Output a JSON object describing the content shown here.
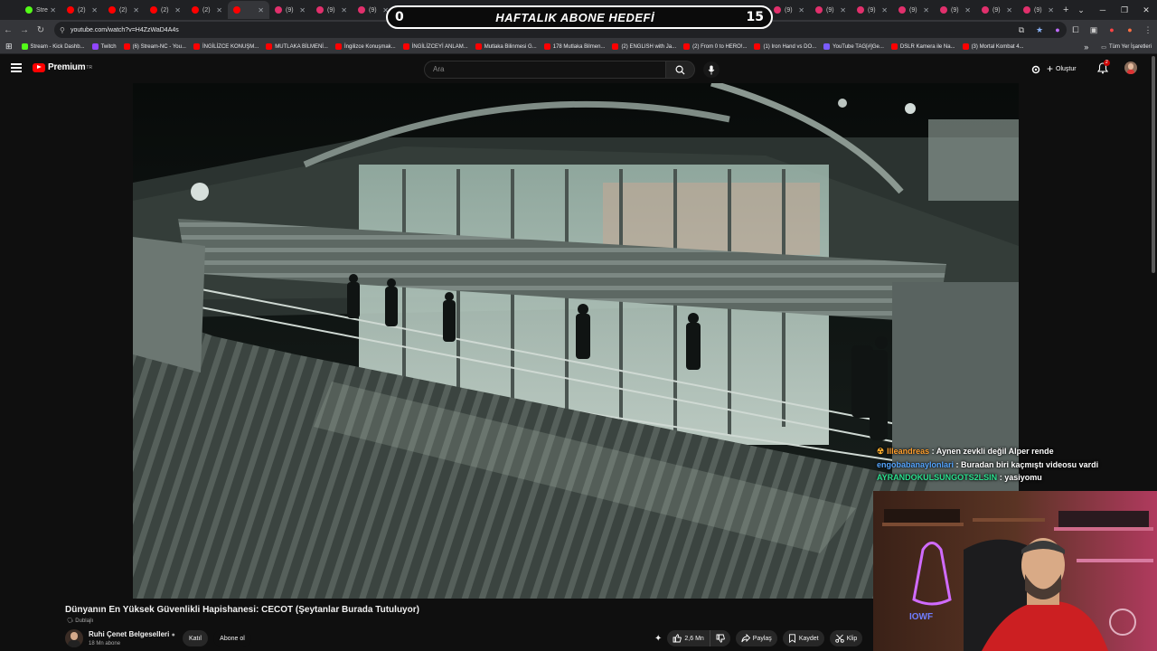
{
  "browser": {
    "tabs": [
      {
        "label": "Stre",
        "color": "#53fc18",
        "icon": "kick-icon"
      },
      {
        "label": "(2)",
        "color": "#ff0000",
        "icon": "youtube-icon"
      },
      {
        "label": "(2)",
        "color": "#ff0000",
        "icon": "youtube-icon"
      },
      {
        "label": "(2)",
        "color": "#ff0000",
        "icon": "youtube-icon"
      },
      {
        "label": "(2)",
        "color": "#ff0000",
        "icon": "youtube-icon"
      },
      {
        "label": "",
        "color": "#ff0000",
        "icon": "youtube-icon",
        "active": true
      },
      {
        "label": "(9)",
        "color": "#e1306c",
        "icon": "instagram-icon"
      },
      {
        "label": "(9)",
        "color": "#e1306c",
        "icon": "instagram-icon"
      },
      {
        "label": "(9)",
        "color": "#e1306c",
        "icon": "instagram-icon"
      },
      {
        "label": "(9)",
        "color": "#e1306c",
        "icon": "instagram-icon"
      },
      {
        "label": "(9)",
        "color": "#e1306c",
        "icon": "instagram-icon"
      },
      {
        "label": "(9)",
        "color": "#e1306c",
        "icon": "instagram-icon"
      },
      {
        "label": "(9)",
        "color": "#e1306c",
        "icon": "instagram-icon"
      },
      {
        "label": "(9)",
        "color": "#e1306c",
        "icon": "instagram-icon"
      },
      {
        "label": "(9)",
        "color": "#e1306c",
        "icon": "instagram-icon"
      },
      {
        "label": "(9)",
        "color": "#e1306c",
        "icon": "instagram-icon"
      },
      {
        "label": "(9)",
        "color": "#e1306c",
        "icon": "instagram-icon"
      },
      {
        "label": "(9)",
        "color": "#e1306c",
        "icon": "instagram-icon"
      },
      {
        "label": "(9)",
        "color": "#e1306c",
        "icon": "instagram-icon"
      },
      {
        "label": "(9)",
        "color": "#e1306c",
        "icon": "instagram-icon"
      },
      {
        "label": "(9)",
        "color": "#e1306c",
        "icon": "instagram-icon"
      },
      {
        "label": "(9)",
        "color": "#e1306c",
        "icon": "instagram-icon"
      },
      {
        "label": "(9)",
        "color": "#e1306c",
        "icon": "instagram-icon"
      },
      {
        "label": "(9)",
        "color": "#e1306c",
        "icon": "instagram-icon"
      },
      {
        "label": "(9)",
        "color": "#e1306c",
        "icon": "instagram-icon"
      }
    ],
    "url": "youtube.com/watch?v=H4ZzWaD4A4s",
    "bookmarks": [
      {
        "label": "Stream - Kick Dashb...",
        "color": "#53fc18"
      },
      {
        "label": "Twitch",
        "color": "#9146ff"
      },
      {
        "label": "(6) Stream-NC - You...",
        "color": "#ff0000"
      },
      {
        "label": "İNGİLİZCE KONUŞM...",
        "color": "#ff0000"
      },
      {
        "label": "MUTLAKA BİLMENİ...",
        "color": "#ff0000"
      },
      {
        "label": "İngilizce Konuşmak...",
        "color": "#ff0000"
      },
      {
        "label": "İNGİLİZCEYİ ANLAM...",
        "color": "#ff0000"
      },
      {
        "label": "Mutlaka Bilinmesi G...",
        "color": "#ff0000"
      },
      {
        "label": "178 Mutlaka Bilmen...",
        "color": "#ff0000"
      },
      {
        "label": "(2) ENGLISH with Ja...",
        "color": "#ff0000"
      },
      {
        "label": "(2) From 0 to HERO!...",
        "color": "#ff0000"
      },
      {
        "label": "(1) Iron Hand vs DO...",
        "color": "#ff0000"
      },
      {
        "label": "YouTube TAG[#]Ge...",
        "color": "#7b5cff"
      },
      {
        "label": "DSLR Kamera ile Na...",
        "color": "#ff0000"
      },
      {
        "label": "(3) Mortal Kombat 4...",
        "color": "#ff0000"
      }
    ],
    "bookmarks_more": "»",
    "all_bookmarks": "Tüm Yer İşaretleri"
  },
  "overlay": {
    "left_count": "0",
    "title": "HAFTALIK ABONE HEDEFİ",
    "right_count": "15"
  },
  "youtube": {
    "logo_text": "Premium",
    "logo_sup": "TR",
    "search_placeholder": "Ara",
    "create_label": "Oluştur",
    "notification_count": "2"
  },
  "chat": [
    {
      "badge": "☢",
      "user": "Illeandreas",
      "user_color": "#ff9f2e",
      "message": "Aynen zevkli değil Alper rende"
    },
    {
      "badge": "",
      "user": "engobabanaylonlari",
      "user_color": "#56a6ff",
      "message": "Buradan biri kaçmıştı videosu vardi"
    },
    {
      "badge": "",
      "user": "AYRANDOKULSUNGOTS2LSIN",
      "user_color": "#2be08f",
      "message": "yasiyomu"
    }
  ],
  "video": {
    "title": "Dünyanın En Yüksek Güvenlikli Hapishanesi: CECOT (Şeytanlar Burada Tutuluyor)",
    "dub_tag": "Dublajlı",
    "channel_name": "Ruhi Çenet Belgeselleri",
    "channel_subs": "18 Mn abone",
    "join_label": "Katıl",
    "subscribe_label": "Abone ol",
    "like_count": "2,6 Mn",
    "share_label": "Paylaş",
    "save_label": "Kaydet",
    "clip_label": "Klip"
  }
}
